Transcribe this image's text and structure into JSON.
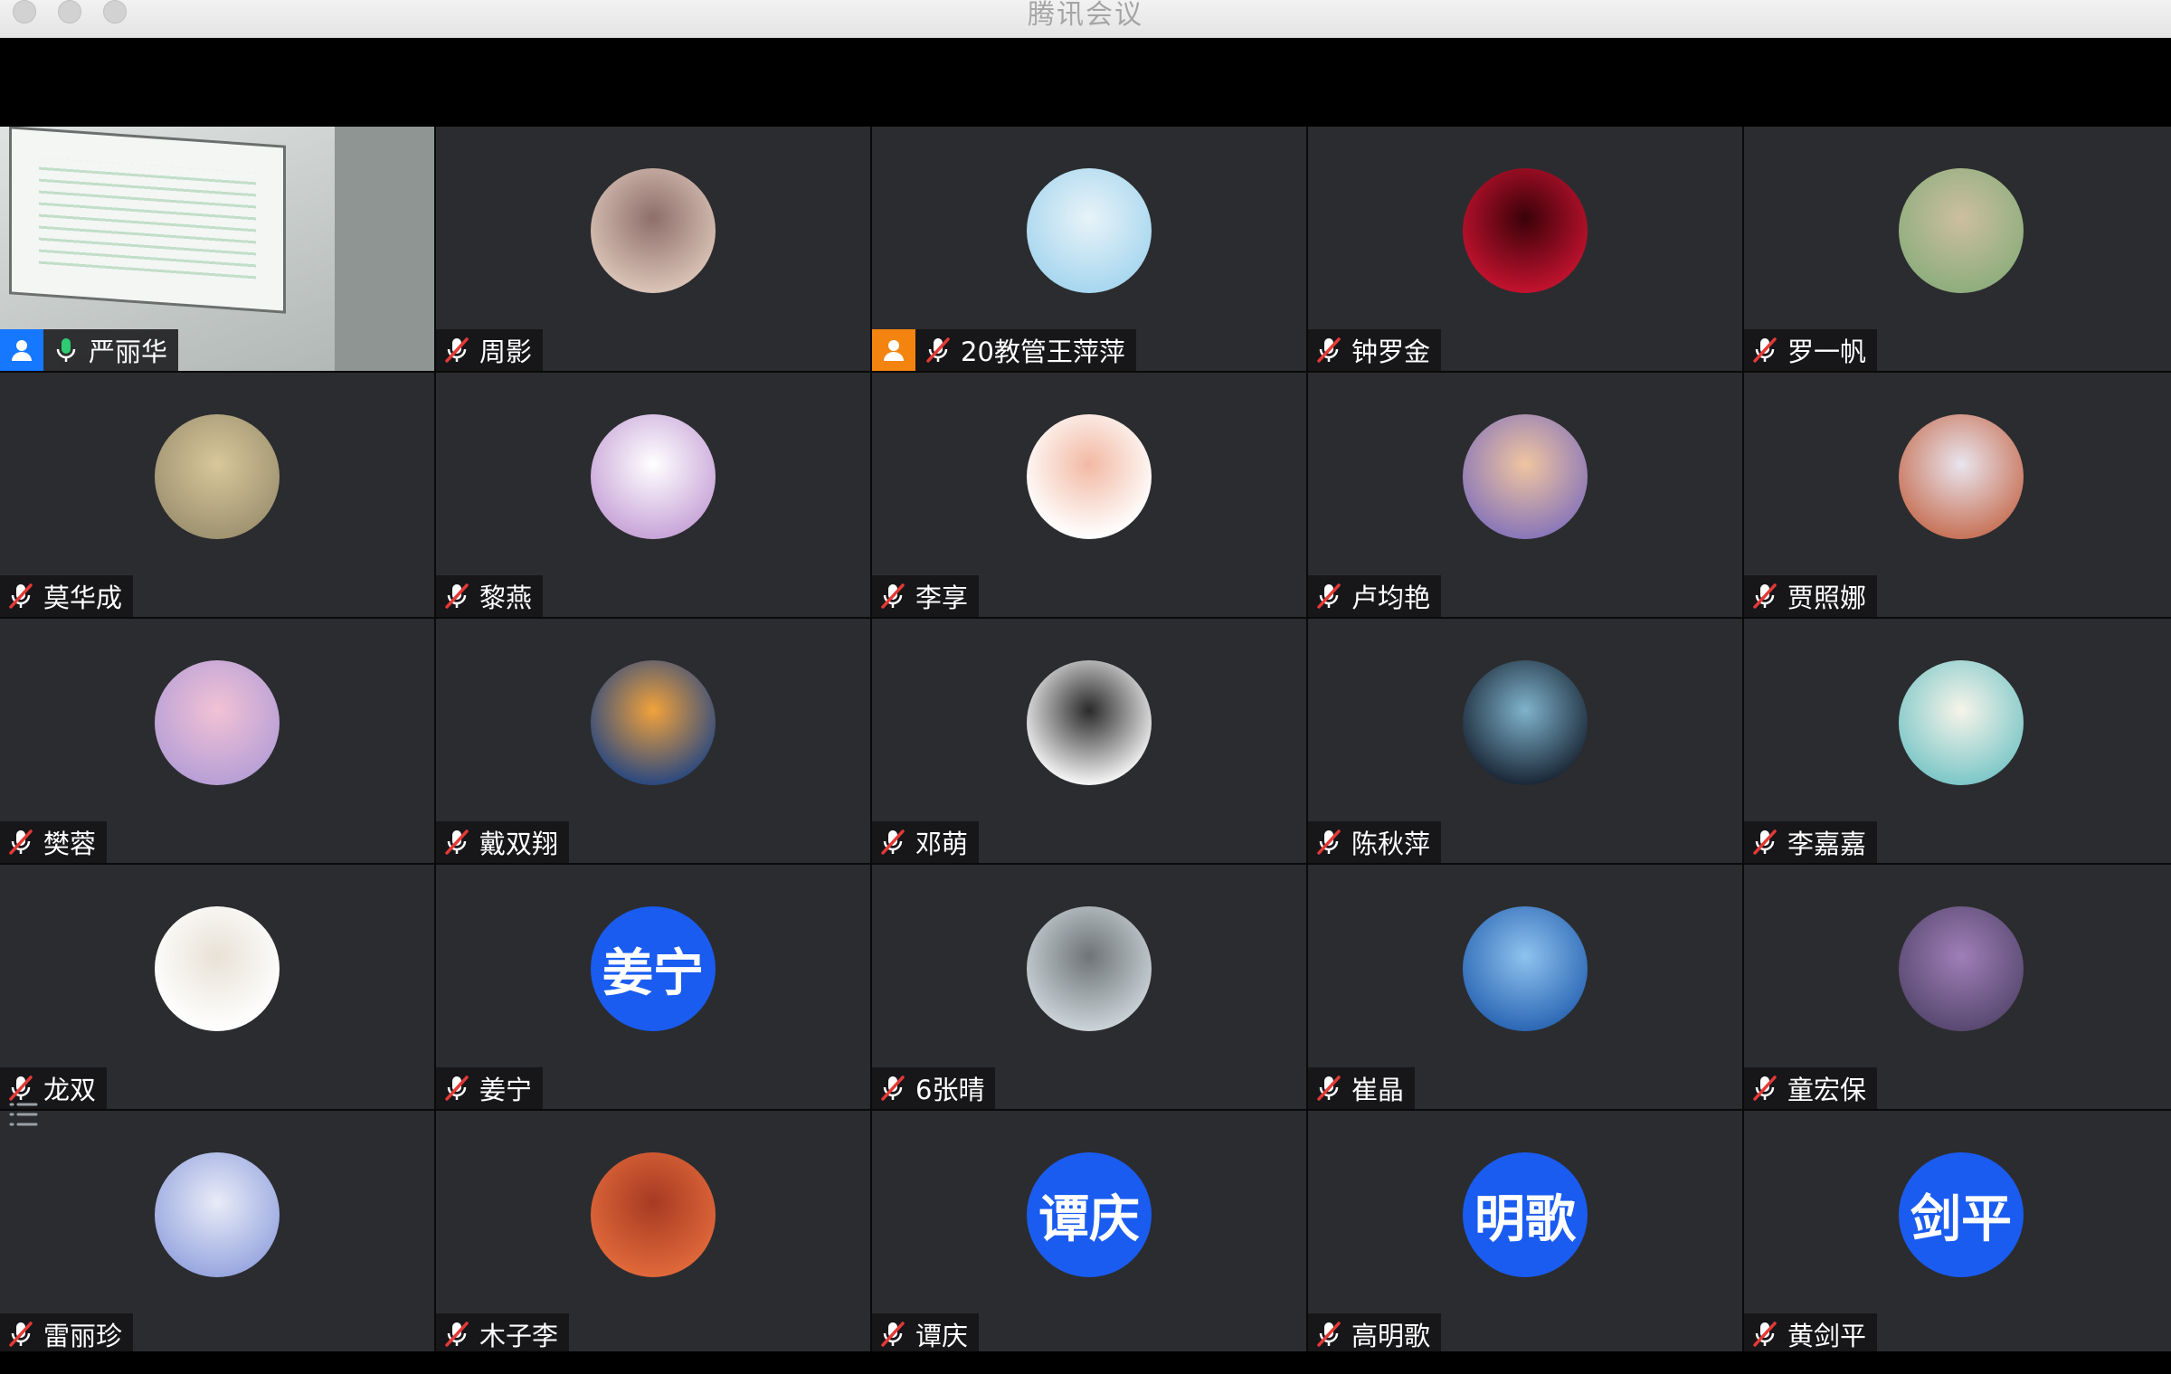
{
  "window": {
    "title": "腾讯会议"
  },
  "participants": [
    {
      "name": "严丽华",
      "mic": "on",
      "host": "blue",
      "avatar": "projector-video",
      "active": true
    },
    {
      "name": "周影",
      "mic": "muted",
      "avatar": "photo",
      "colors": [
        "#d9c2b6",
        "#8e6f6a"
      ]
    },
    {
      "name": "20教管王萍萍",
      "mic": "muted",
      "host": "orange",
      "avatar": "photo",
      "colors": [
        "#a8d7ef",
        "#e8f3f8"
      ]
    },
    {
      "name": "钟罗金",
      "mic": "muted",
      "avatar": "photo",
      "colors": [
        "#c1122e",
        "#3a0209"
      ]
    },
    {
      "name": "罗一帆",
      "mic": "muted",
      "avatar": "photo",
      "colors": [
        "#8fae7e",
        "#cdbf9f"
      ]
    },
    {
      "name": "莫华成",
      "mic": "muted",
      "avatar": "photo",
      "colors": [
        "#a09472",
        "#d8c79a"
      ]
    },
    {
      "name": "黎燕",
      "mic": "muted",
      "avatar": "photo",
      "colors": [
        "#c9a6d9",
        "#ffffff"
      ]
    },
    {
      "name": "李享",
      "mic": "muted",
      "avatar": "photo",
      "colors": [
        "#ffffff",
        "#f2b9a3"
      ]
    },
    {
      "name": "卢均艳",
      "mic": "muted",
      "avatar": "photo",
      "colors": [
        "#8b78b8",
        "#f0c5a0"
      ]
    },
    {
      "name": "贾照娜",
      "mic": "muted",
      "avatar": "photo",
      "colors": [
        "#c8755b",
        "#e9e5ee"
      ]
    },
    {
      "name": "樊蓉",
      "mic": "muted",
      "avatar": "photo",
      "colors": [
        "#b8a0d6",
        "#f2c2d5"
      ]
    },
    {
      "name": "戴双翔",
      "mic": "muted",
      "avatar": "photo",
      "colors": [
        "#2e4a7e",
        "#f2a23b"
      ]
    },
    {
      "name": "邓萌",
      "mic": "muted",
      "avatar": "photo",
      "colors": [
        "#f3f3f3",
        "#2a2a2a"
      ]
    },
    {
      "name": "陈秋萍",
      "mic": "muted",
      "avatar": "photo",
      "colors": [
        "#1c2a3a",
        "#7fb3cc"
      ]
    },
    {
      "name": "李嘉嘉",
      "mic": "muted",
      "avatar": "photo",
      "colors": [
        "#7fc8c9",
        "#f7f4e9"
      ]
    },
    {
      "name": "龙双",
      "mic": "muted",
      "avatar": "photo",
      "colors": [
        "#ffffff",
        "#e8e2d6"
      ]
    },
    {
      "name": "姜宁",
      "mic": "muted",
      "avatar": "text",
      "avatar_text": "姜宁"
    },
    {
      "name": "6张晴",
      "mic": "muted",
      "avatar": "photo",
      "colors": [
        "#c9d2d6",
        "#6e7478"
      ]
    },
    {
      "name": "崔晶",
      "mic": "muted",
      "avatar": "photo",
      "colors": [
        "#2e69b6",
        "#8ec3ee"
      ]
    },
    {
      "name": "童宏保",
      "mic": "muted",
      "avatar": "photo",
      "colors": [
        "#5a4a72",
        "#9f7fb8"
      ]
    },
    {
      "name": "雷丽珍",
      "mic": "muted",
      "avatar": "photo",
      "colors": [
        "#9aa8e0",
        "#e8ecf7"
      ]
    },
    {
      "name": "木子李",
      "mic": "muted",
      "avatar": "photo",
      "colors": [
        "#e0683a",
        "#a63a22"
      ]
    },
    {
      "name": "谭庆",
      "mic": "muted",
      "avatar": "text",
      "avatar_text": "谭庆"
    },
    {
      "name": "高明歌",
      "mic": "muted",
      "avatar": "text",
      "avatar_text": "明歌"
    },
    {
      "name": "黄剑平",
      "mic": "muted",
      "avatar": "text",
      "avatar_text": "剑平"
    }
  ],
  "colors": {
    "active_border": "#1ecb4f",
    "text_avatar_bg": "#1a5cf0",
    "mic_muted": "#e53935",
    "mic_on": "#2ecc71"
  }
}
